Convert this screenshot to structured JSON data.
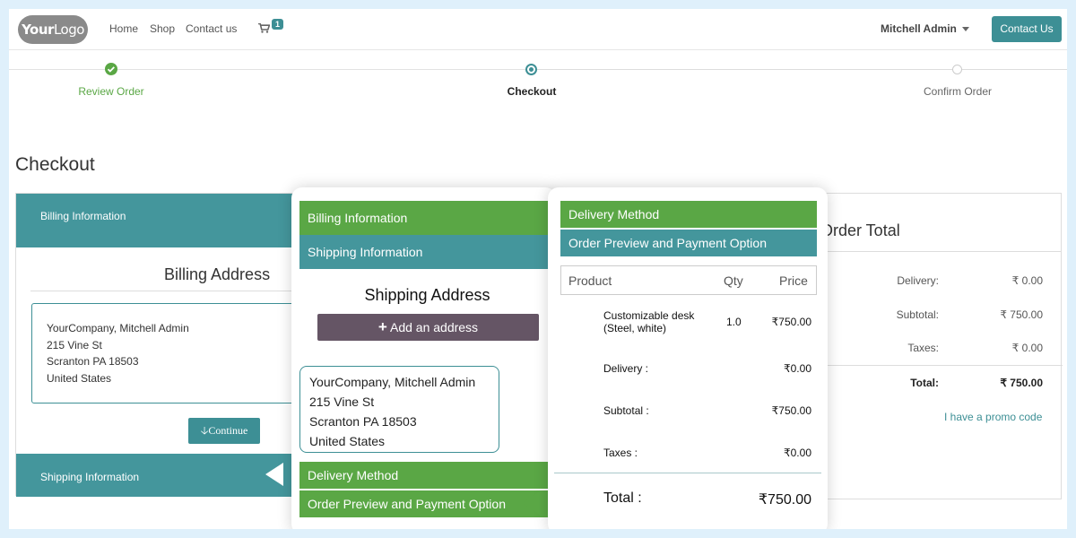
{
  "navbar": {
    "logo_bold": "Your",
    "logo_light": "Logo",
    "links": [
      "Home",
      "Shop",
      "Contact us"
    ],
    "cart_count": "1",
    "user": "Mitchell Admin",
    "contact_button": "Contact Us"
  },
  "progress": {
    "steps": [
      "Review Order",
      "Checkout",
      "Confirm Order"
    ]
  },
  "page_title": "Checkout",
  "left_card": {
    "billing_header": "Billing Information",
    "billing_title": "Billing Address",
    "address": [
      "YourCompany, Mitchell Admin",
      "215 Vine St",
      "Scranton PA 18503",
      "United States"
    ],
    "continue_label": "Continue",
    "shipping_header": "Shipping Information"
  },
  "order_total": {
    "title": "Order Total",
    "rows": [
      {
        "label": "Delivery:",
        "value": "₹ 0.00"
      },
      {
        "label": "Subtotal:",
        "value": "₹ 750.00"
      },
      {
        "label": "Taxes:",
        "value": "₹ 0.00"
      }
    ],
    "total_label": "Total:",
    "total_value": "₹ 750.00",
    "promo": "I have a promo code"
  },
  "panel1": {
    "billing": "Billing Information",
    "shipping": "Shipping Information",
    "shipping_title": "Shipping Address",
    "add_address": "Add an address",
    "address": [
      "YourCompany, Mitchell Admin",
      "215 Vine St",
      "Scranton PA 18503",
      "United States"
    ],
    "delivery": "Delivery Method",
    "preview": "Order Preview and Payment Option"
  },
  "panel2": {
    "delivery": "Delivery Method",
    "preview": "Order Preview and Payment Option",
    "headers": [
      "Product",
      "Qty",
      "Price"
    ],
    "product": {
      "name_line1": "Customizable desk",
      "name_line2": "(Steel, white)",
      "qty": "1.0",
      "price": "₹750.00"
    },
    "rows": [
      {
        "label": "Delivery :",
        "value": "₹0.00"
      },
      {
        "label": "Subtotal :",
        "value": "₹750.00"
      },
      {
        "label": "Taxes :",
        "value": "₹0.00"
      }
    ],
    "total_label": "Total :",
    "total_value": "₹750.00"
  },
  "colors": {
    "teal": "#44969c",
    "green": "#5aa745",
    "purple": "#655565"
  }
}
